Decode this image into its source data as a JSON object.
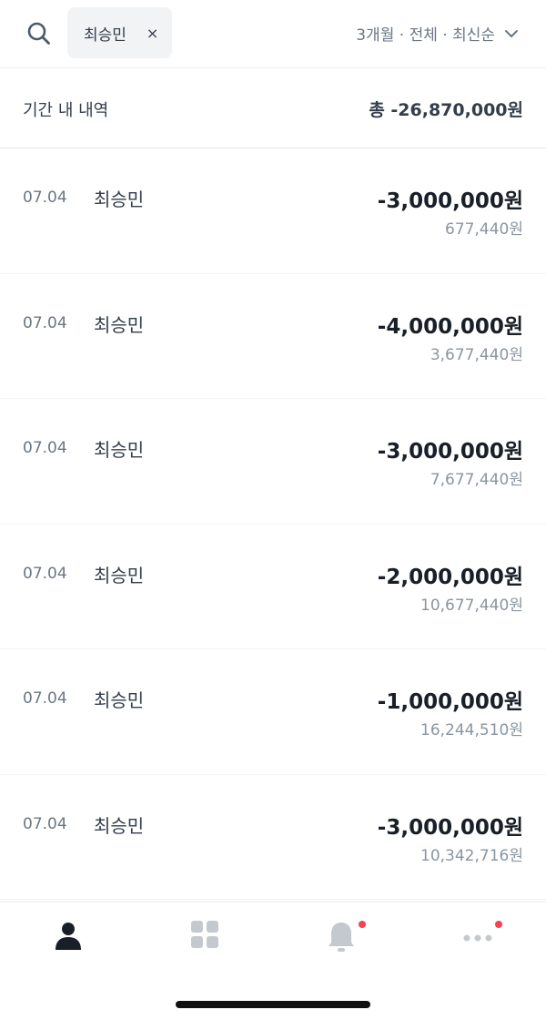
{
  "header": {
    "search_icon": "search-icon",
    "chip": {
      "label": "최승민",
      "close_symbol": "×"
    },
    "filter": {
      "label": "3개월 · 전체 · 최신순",
      "chevron_icon": "chevron-down-icon"
    }
  },
  "summary": {
    "label": "기간 내 내역",
    "total": "총 -26,870,000원"
  },
  "transactions": [
    {
      "date": "07.04",
      "name": "최승민",
      "amount": "-3,000,000원",
      "balance": "677,440원"
    },
    {
      "date": "07.04",
      "name": "최승민",
      "amount": "-4,000,000원",
      "balance": "3,677,440원"
    },
    {
      "date": "07.04",
      "name": "최승민",
      "amount": "-3,000,000원",
      "balance": "7,677,440원"
    },
    {
      "date": "07.04",
      "name": "최승민",
      "amount": "-2,000,000원",
      "balance": "10,677,440원"
    },
    {
      "date": "07.04",
      "name": "최승민",
      "amount": "-1,000,000원",
      "balance": "16,244,510원"
    },
    {
      "date": "07.04",
      "name": "최승민",
      "amount": "-3,000,000원",
      "balance": "10,342,716원"
    }
  ],
  "tabbar": {
    "tabs": [
      {
        "icon": "person-icon",
        "active": true,
        "badge": false
      },
      {
        "icon": "grid-icon",
        "active": false,
        "badge": false
      },
      {
        "icon": "bell-icon",
        "active": false,
        "badge": true
      },
      {
        "icon": "more-icon",
        "active": false,
        "badge": true
      }
    ],
    "badge_color": "#f04452"
  }
}
